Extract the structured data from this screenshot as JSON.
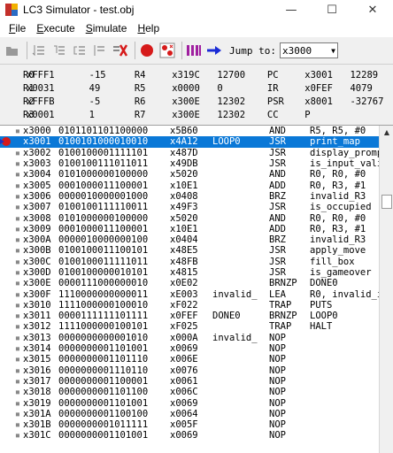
{
  "window": {
    "title": "LC3 Simulator - test.obj",
    "minimize": "—",
    "maximize": "☐",
    "close": "✕"
  },
  "menu": [
    {
      "label": "File",
      "key": "F",
      "rest": "ile"
    },
    {
      "label": "Execute",
      "key": "E",
      "rest": "xecute"
    },
    {
      "label": "Simulate",
      "key": "S",
      "rest": "imulate"
    },
    {
      "label": "Help",
      "key": "H",
      "rest": "elp"
    }
  ],
  "toolbar": {
    "jump_label": "Jump to:",
    "jump_value": "x3000",
    "icons": [
      "open-file-icon",
      "step-over-icon",
      "step-into-icon",
      "step-out-icon",
      "finish-icon",
      "stop-icon",
      "breakpoint-icon",
      "clear-breakpoints-icon",
      "memory-icon",
      "goto-icon"
    ]
  },
  "registers": [
    {
      "n1": "R0",
      "h1": "xFFF1",
      "d1": "-15",
      "n2": "R4",
      "h2": "x319C",
      "d2": "12700",
      "n3": "PC",
      "h3": "x3001",
      "d3": "12289"
    },
    {
      "n1": "R1",
      "h1": "x0031",
      "d1": "49",
      "n2": "R5",
      "h2": "x0000",
      "d2": "0",
      "n3": "IR",
      "h3": "x0FEF",
      "d3": "4079"
    },
    {
      "n1": "R2",
      "h1": "xFFFB",
      "d1": "-5",
      "n2": "R6",
      "h2": "x300E",
      "d2": "12302",
      "n3": "PSR",
      "h3": "x8001",
      "d3": "-32767"
    },
    {
      "n1": "R3",
      "h1": "x0001",
      "d1": "1",
      "n2": "R7",
      "h2": "x300E",
      "d2": "12302",
      "n3": "CC",
      "h3": "P",
      "d3": ""
    }
  ],
  "listing": [
    {
      "mark": "▪",
      "addr": "x3000",
      "bin": "0101101101100000",
      "hex": "x5B60",
      "label": "",
      "op": "AND",
      "args": "R5, R5, #0"
    },
    {
      "mark": "",
      "addr": "x3001",
      "bin": "0100101000010010",
      "hex": "x4A12",
      "label": "LOOP0",
      "op": "JSR",
      "args": "print_map",
      "selected": true,
      "breakpoint": true
    },
    {
      "mark": "▪",
      "addr": "x3002",
      "bin": "0100100001111101",
      "hex": "x487D",
      "label": "",
      "op": "JSR",
      "args": "display_prompt"
    },
    {
      "mark": "▪",
      "addr": "x3003",
      "bin": "0100100111011011",
      "hex": "x49DB",
      "label": "",
      "op": "JSR",
      "args": "is_input_valid"
    },
    {
      "mark": "▪",
      "addr": "x3004",
      "bin": "0101000000100000",
      "hex": "x5020",
      "label": "",
      "op": "AND",
      "args": "R0, R0, #0"
    },
    {
      "mark": "▪",
      "addr": "x3005",
      "bin": "0001000011100001",
      "hex": "x10E1",
      "label": "",
      "op": "ADD",
      "args": "R0, R3, #1"
    },
    {
      "mark": "▪",
      "addr": "x3006",
      "bin": "0000010000001000",
      "hex": "x0408",
      "label": "",
      "op": "BRZ",
      "args": "invalid_R3"
    },
    {
      "mark": "▪",
      "addr": "x3007",
      "bin": "0100100111110011",
      "hex": "x49F3",
      "label": "",
      "op": "JSR",
      "args": "is_occupied"
    },
    {
      "mark": "▪",
      "addr": "x3008",
      "bin": "0101000000100000",
      "hex": "x5020",
      "label": "",
      "op": "AND",
      "args": "R0, R0, #0"
    },
    {
      "mark": "▪",
      "addr": "x3009",
      "bin": "0001000011100001",
      "hex": "x10E1",
      "label": "",
      "op": "ADD",
      "args": "R0, R3, #1"
    },
    {
      "mark": "▪",
      "addr": "x300A",
      "bin": "0000010000000100",
      "hex": "x0404",
      "label": "",
      "op": "BRZ",
      "args": "invalid_R3"
    },
    {
      "mark": "▪",
      "addr": "x300B",
      "bin": "0100100011100101",
      "hex": "x48E5",
      "label": "",
      "op": "JSR",
      "args": "apply_move"
    },
    {
      "mark": "▪",
      "addr": "x300C",
      "bin": "0100100011111011",
      "hex": "x48FB",
      "label": "",
      "op": "JSR",
      "args": "fill_box"
    },
    {
      "mark": "▪",
      "addr": "x300D",
      "bin": "0100100000010101",
      "hex": "x4815",
      "label": "",
      "op": "JSR",
      "args": "is_gameover"
    },
    {
      "mark": "▪",
      "addr": "x300E",
      "bin": "0000111000000010",
      "hex": "x0E02",
      "label": "",
      "op": "BRNZP",
      "args": "DONE0"
    },
    {
      "mark": "▪",
      "addr": "x300F",
      "bin": "1110000000000011",
      "hex": "xE003",
      "label": "invalid_",
      "op": "LEA",
      "args": "R0, invalid_inp"
    },
    {
      "mark": "▪",
      "addr": "x3010",
      "bin": "1111000000100010",
      "hex": "xF022",
      "label": "",
      "op": "TRAP",
      "args": "PUTS"
    },
    {
      "mark": "▪",
      "addr": "x3011",
      "bin": "0000111111101111",
      "hex": "x0FEF",
      "label": "DONE0",
      "op": "BRNZP",
      "args": "LOOP0"
    },
    {
      "mark": "▪",
      "addr": "x3012",
      "bin": "1111000000100101",
      "hex": "xF025",
      "label": "",
      "op": "TRAP",
      "args": "HALT"
    },
    {
      "mark": "▪",
      "addr": "x3013",
      "bin": "0000000000001010",
      "hex": "x000A",
      "label": "invalid_",
      "op": "NOP",
      "args": ""
    },
    {
      "mark": "▪",
      "addr": "x3014",
      "bin": "0000000001101001",
      "hex": "x0069",
      "label": "",
      "op": "NOP",
      "args": ""
    },
    {
      "mark": "▪",
      "addr": "x3015",
      "bin": "0000000001101110",
      "hex": "x006E",
      "label": "",
      "op": "NOP",
      "args": ""
    },
    {
      "mark": "▪",
      "addr": "x3016",
      "bin": "0000000001110110",
      "hex": "x0076",
      "label": "",
      "op": "NOP",
      "args": ""
    },
    {
      "mark": "▪",
      "addr": "x3017",
      "bin": "0000000001100001",
      "hex": "x0061",
      "label": "",
      "op": "NOP",
      "args": ""
    },
    {
      "mark": "▪",
      "addr": "x3018",
      "bin": "0000000001101100",
      "hex": "x006C",
      "label": "",
      "op": "NOP",
      "args": ""
    },
    {
      "mark": "▪",
      "addr": "x3019",
      "bin": "0000000001101001",
      "hex": "x0069",
      "label": "",
      "op": "NOP",
      "args": ""
    },
    {
      "mark": "▪",
      "addr": "x301A",
      "bin": "0000000001100100",
      "hex": "x0064",
      "label": "",
      "op": "NOP",
      "args": ""
    },
    {
      "mark": "▪",
      "addr": "x301B",
      "bin": "0000000001011111",
      "hex": "x005F",
      "label": "",
      "op": "NOP",
      "args": ""
    },
    {
      "mark": "▪",
      "addr": "x301C",
      "bin": "0000000001101001",
      "hex": "x0069",
      "label": "",
      "op": "NOP",
      "args": ""
    }
  ],
  "colors": {
    "selection": "#0a78d7",
    "breakpoint": "#d61a1a",
    "pc_pointer": "#2030c0"
  }
}
